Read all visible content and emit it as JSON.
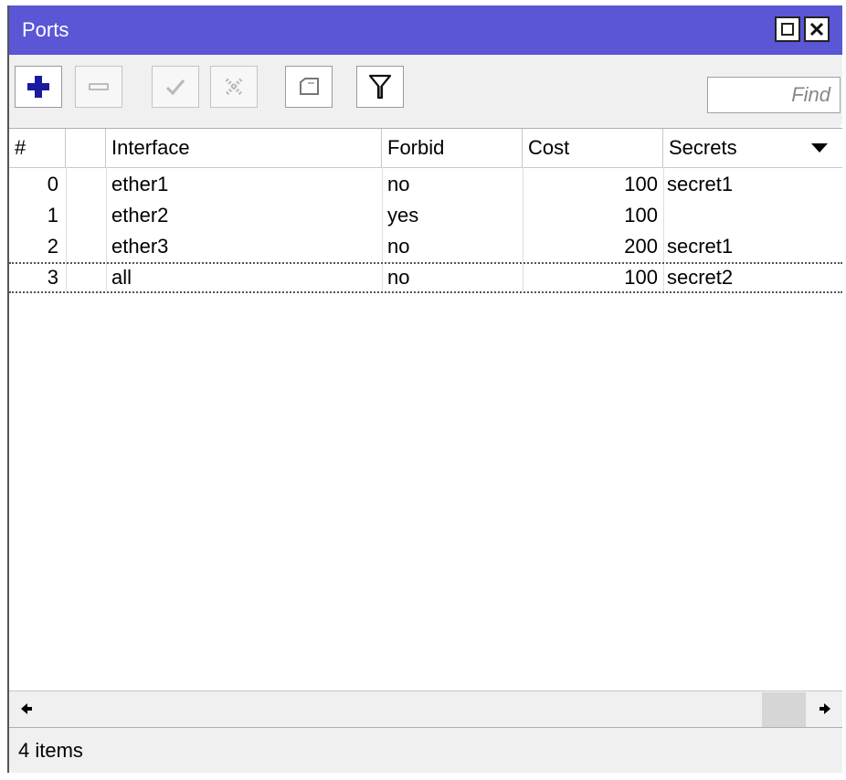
{
  "window": {
    "title": "Ports"
  },
  "toolbar": {
    "add_icon": "plus-icon",
    "remove_icon": "minus-icon",
    "enable_icon": "check-icon",
    "disable_icon": "x-icon",
    "comment_icon": "note-icon",
    "filter_icon": "filter-icon",
    "find_placeholder": "Find"
  },
  "table": {
    "columns": [
      "#",
      "",
      "Interface",
      "Forbid",
      "Cost",
      "Secrets"
    ],
    "rows": [
      {
        "num": "0",
        "interface": "ether1",
        "forbid": "no",
        "cost": "100",
        "secrets": "secret1"
      },
      {
        "num": "1",
        "interface": "ether2",
        "forbid": "yes",
        "cost": "100",
        "secrets": ""
      },
      {
        "num": "2",
        "interface": "ether3",
        "forbid": "no",
        "cost": "200",
        "secrets": "secret1"
      },
      {
        "num": "3",
        "interface": "all",
        "forbid": "no",
        "cost": "100",
        "secrets": "secret2"
      }
    ]
  },
  "status": {
    "items_text": "4 items"
  },
  "colors": {
    "titlebar": "#5a56d6",
    "add_icon": "#1a1aa0"
  }
}
